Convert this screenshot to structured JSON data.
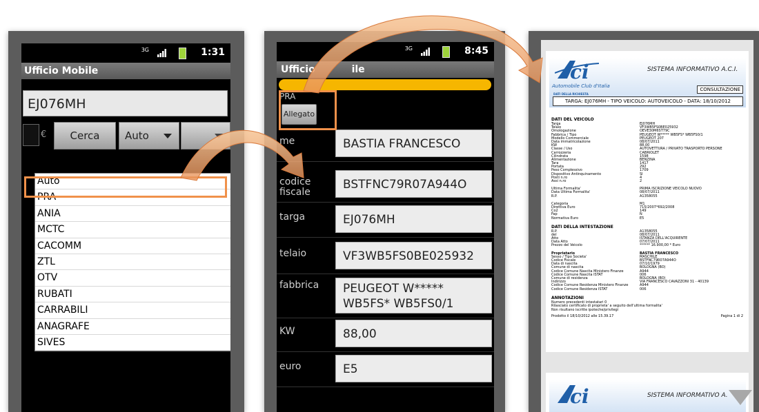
{
  "phone1": {
    "status": {
      "network": "3G",
      "time": "1:31"
    },
    "app_title": "Ufficio Mobile",
    "plate_value": "EJ076MH",
    "currency_label": "€",
    "search_button": "Cerca",
    "type_selected": "Auto",
    "dropdown_options": [
      "Auto",
      "PRA",
      "ANIA",
      "MCTC",
      "CACOMM",
      "ZTL",
      "OTV",
      "RUBATI",
      "CARRABILI",
      "ANAGRAFE",
      "SIVES"
    ]
  },
  "phone2": {
    "status": {
      "network": "3G",
      "time": "8:45"
    },
    "app_title_left": "Ufficio",
    "app_title_right": "ile",
    "section_label": "PRA",
    "attachment_button": "Allegato",
    "rows": [
      {
        "label": "me",
        "value": "BASTIA FRANCESCO"
      },
      {
        "label": "codice fiscale",
        "value": "BSTFNC79R07A944O"
      },
      {
        "label": "targa",
        "value": "EJ076MH"
      },
      {
        "label": "telaio",
        "value": "VF3WB5FS0BE025932"
      },
      {
        "label": "fabbrica",
        "value": " PEUGEOT W***** WB5FS* WB5FS0/1"
      },
      {
        "label": "KW",
        "value": "88,00"
      },
      {
        "label": "euro",
        "value": "E5"
      }
    ]
  },
  "document": {
    "logo_text": "ACI",
    "org_name": "Automobile Club d'Italia",
    "system_title": "SISTEMA INFORMATIVO A.C.I.",
    "consult_label": "CONSULTAZIONE",
    "request_label": "DATI DELLA RICHIESTA",
    "request_line": "TARGA: EJ076MH - TIPO VEICOLO: AUTOVEICOLO - DATA: 18/10/2012",
    "vehicle_header": "DATI DEL VEICOLO",
    "vehicle_rows": [
      [
        "Targa",
        "EJ076MH"
      ],
      [
        "Telaio",
        "VF3WB5FS0BE025932"
      ],
      [
        "Omologazione",
        "OEVE30M6ST79C"
      ],
      [
        "Fabbrica / Tipo",
        "PEUGEOT W***** WB5FS* WB5FS0/1"
      ],
      [
        "Modello Commerciale",
        "PEUGEOT 207"
      ],
      [
        "Data immatricolazione",
        "08/07/2011"
      ],
      [
        "KW",
        "88,00"
      ],
      [
        "Classe / Uso",
        "AUTOVETTURA / PRIVATO TRASPORTO PERSONE"
      ],
      [
        "Carrozzeria",
        "CABRIOLET"
      ],
      [
        "Cilindrata",
        "1598"
      ],
      [
        "Alimentazione",
        "BENZINA"
      ],
      [
        "Tara",
        "1417"
      ],
      [
        "Portata",
        "292"
      ],
      [
        "Peso Complessivo",
        "1709"
      ],
      [
        "Dispositivo Antinquinamento",
        "SI"
      ],
      [
        "Posti n.ro",
        "4"
      ],
      [
        "Assi n.ro",
        "2"
      ]
    ],
    "formality_rows": [
      [
        "Ultima Formalita'",
        "PRIMA ISCRIZIONE VEICOLO NUOVO"
      ],
      [
        "Data Ultima Formalita'",
        "08/07/2011"
      ],
      [
        "R.P.",
        "A1358055"
      ]
    ],
    "category_rows": [
      [
        "Categoria",
        "M1"
      ],
      [
        "Direttiva Euro",
        "715/2007*692/2008"
      ],
      [
        "Co2",
        "149"
      ],
      [
        "Fap",
        "N"
      ],
      [
        "Normativa Euro",
        "E5"
      ]
    ],
    "holder_header": "DATI DELLA INTESTAZIONE",
    "holder_rows": [
      [
        "R.P.",
        "A1358055"
      ],
      [
        "del",
        "08/07/2011"
      ],
      [
        "Atto",
        "ISTANZA DELL'ACQUIRENTE"
      ],
      [
        "Data Atto",
        "07/07/2011"
      ],
      [
        "Prezzo del Veicolo",
        "****** 16.900,00 * Euro"
      ]
    ],
    "owner_rows": [
      [
        "Proprietario",
        "BASTIA FRANCESCO"
      ],
      [
        "Sesso / Tipo Societa'",
        "MASCHILE"
      ],
      [
        "Codice Fiscale",
        "BSTFNC79R07A944O"
      ],
      [
        "Data di nascita",
        "07/10/1979"
      ],
      [
        "Comune di nascita",
        "BOLOGNA (BO)"
      ],
      [
        "Codice Comune Nascita Ministero Finanze",
        "A944"
      ],
      [
        "Codice Comune Nascita ISTAT",
        "006"
      ],
      [
        "Comune di residenza",
        "BOLOGNA (BO)"
      ],
      [
        "Indirizzo",
        "VIA FRANCESCO CAVAZZONI 31 - 40139"
      ],
      [
        "Codice Comune Residenza Ministero Finanze",
        "A944"
      ],
      [
        "Codice Comune Residenza ISTAT",
        "006"
      ]
    ],
    "notes_header": "ANNOTAZIONI",
    "notes": [
      "Numero precedenti intestatari 0",
      "Rilasciato certificato di proprieta' a seguito dell'ultima formalita'",
      "Non risultano iscritte ipoteche/privilegi"
    ],
    "footer_left": "Prodotto il 18/10/2012 alle 15.39.17",
    "footer_right": "Pagina 1 di 2",
    "next_page_title": "SISTEMA INFORMATIVO A."
  },
  "colors": {
    "highlight": "#f0914a",
    "aci_blue": "#1f5fa8",
    "title_bar": "#707070",
    "yellow_bar": "#f6b600"
  }
}
